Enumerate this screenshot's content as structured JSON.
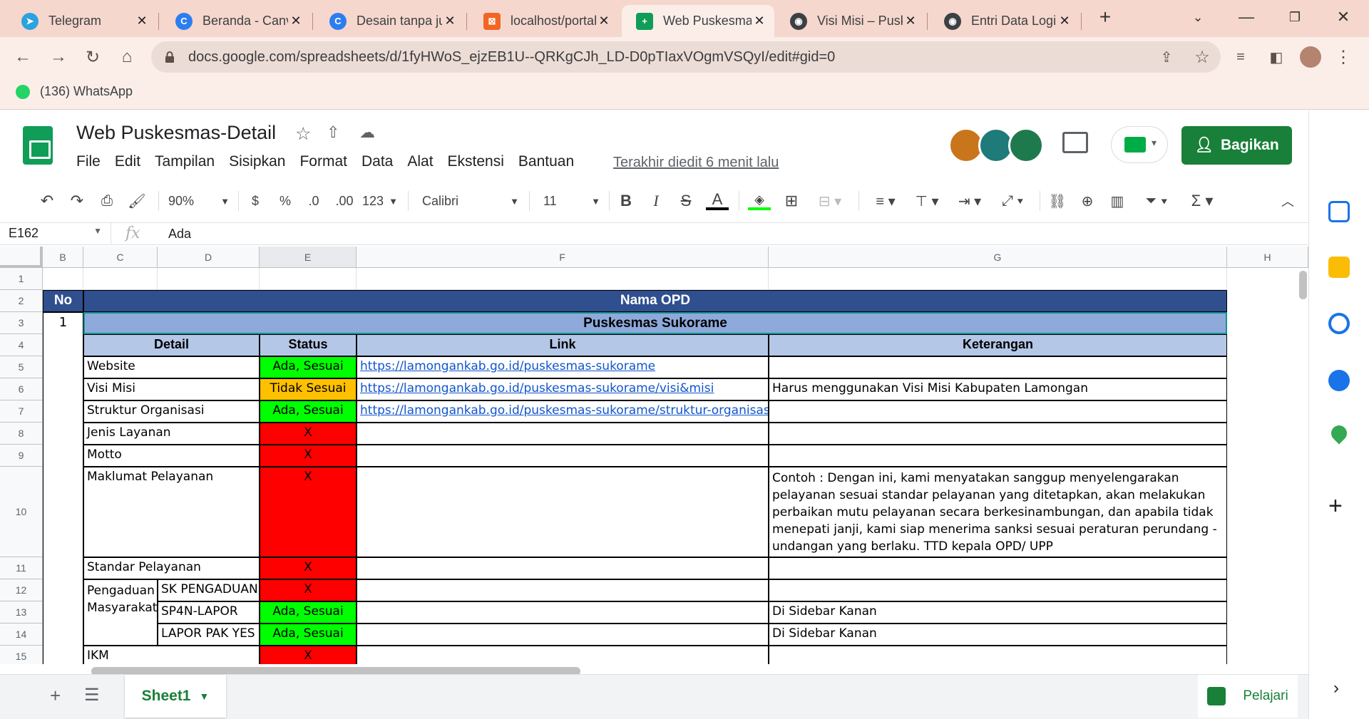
{
  "browser": {
    "tabs": [
      {
        "title": "Telegram",
        "icon": "telegram-icon",
        "color": "#2aa3df"
      },
      {
        "title": "Beranda - Canva",
        "icon": "canva-icon",
        "color": "#2c7ef0"
      },
      {
        "title": "Desain tanpa judul",
        "icon": "canva-icon",
        "color": "#2c7ef0"
      },
      {
        "title": "localhost/portal",
        "icon": "xampp-icon",
        "color": "#f26522"
      },
      {
        "title": "Web Puskesmas",
        "icon": "sheets-icon",
        "color": "#0f9d58"
      },
      {
        "title": "Visi Misi – Pusk",
        "icon": "globe-icon",
        "color": "#3c4043"
      },
      {
        "title": "Entri Data Logi",
        "icon": "globe-icon",
        "color": "#3c4043"
      }
    ],
    "url": "docs.google.com/spreadsheets/d/1fyHWoS_ejzEB1U--QRKgCJh_LD-D0pTIaxVOgmVSQyI/edit#gid=0",
    "bookmark": "(136) WhatsApp"
  },
  "doc": {
    "title": "Web Puskesmas-Detail",
    "menus": [
      "File",
      "Edit",
      "Tampilan",
      "Sisipkan",
      "Format",
      "Data",
      "Alat",
      "Ekstensi",
      "Bantuan"
    ],
    "last_edit": "Terakhir diedit 6 menit lalu",
    "share_label": "Bagikan"
  },
  "toolbar": {
    "zoom": "90%",
    "currency": "$",
    "percent": "%",
    "dec_less": ".0",
    "dec_more": ".00",
    "format_more": "123",
    "font": "Calibri",
    "font_size": "11",
    "bold": "B",
    "italic": "I",
    "strike": "S",
    "text_color": "A"
  },
  "formula": {
    "cell_ref": "E162",
    "fx": "fx",
    "value": "Ada"
  },
  "columns": [
    "B",
    "C",
    "D",
    "E",
    "F",
    "G",
    "H"
  ],
  "rows": [
    "1",
    "2",
    "3",
    "4",
    "5",
    "6",
    "7",
    "8",
    "9",
    "10",
    "11",
    "12",
    "13",
    "14",
    "15"
  ],
  "table": {
    "no_header": "No",
    "opd_header": "Nama OPD",
    "no_value": "1",
    "opd_name": "Puskesmas Sukorame",
    "col_detail": "Detail",
    "col_status": "Status",
    "col_link": "Link",
    "col_keterangan": "Keterangan",
    "items": [
      {
        "detail": "Website",
        "status": "Ada, Sesuai",
        "link": "https://lamongankab.go.id/puskesmas-sukorame",
        "ket": ""
      },
      {
        "detail": "Visi Misi",
        "status": "Tidak Sesuai",
        "link": "https://lamongankab.go.id/puskesmas-sukorame/visi&misi",
        "ket": "Harus menggunakan Visi Misi Kabupaten Lamongan"
      },
      {
        "detail": "Struktur Organisasi",
        "status": "Ada, Sesuai",
        "link": "https://lamongankab.go.id/puskesmas-sukorame/struktur-organisasi",
        "ket": ""
      },
      {
        "detail": "Jenis Layanan",
        "status": "X",
        "link": "",
        "ket": ""
      },
      {
        "detail": "Motto",
        "status": "X",
        "link": "",
        "ket": ""
      },
      {
        "detail": "Maklumat Pelayanan",
        "status": "X",
        "link": "",
        "ket": "Contoh : Dengan ini, kami menyatakan sanggup menyelengarakan pelayanan sesuai standar pelayanan yang ditetapkan, akan melakukan perbaikan mutu pelayanan secara berkesinambungan, dan apabila tidak menepati janji, kami siap menerima sanksi sesuai peraturan perundang -undangan yang berlaku. TTD kepala OPD/ UPP"
      },
      {
        "detail": "Standar Pelayanan",
        "status": "X",
        "link": "",
        "ket": ""
      },
      {
        "detail": "Pengaduan Masyarakat",
        "sub": "SK PENGADUAN",
        "status": "X",
        "link": "",
        "ket": ""
      },
      {
        "sub": "SP4N-LAPOR",
        "status": "Ada, Sesuai",
        "link": "",
        "ket": "Di Sidebar Kanan"
      },
      {
        "sub": "LAPOR PAK YES",
        "status": "Ada, Sesuai",
        "link": "",
        "ket": "Di Sidebar Kanan"
      },
      {
        "detail": "IKM",
        "status": "X",
        "link": "",
        "ket": ""
      }
    ]
  },
  "sheet": {
    "tab": "Sheet1",
    "explore": "Pelajari"
  },
  "colors": {
    "header_dark": "#2f4f8f",
    "header_mid": "#8eaadb",
    "header_light": "#b4c7e7",
    "status_ok": "#00ff00",
    "status_warn": "#ffc000",
    "status_missing": "#ff0000",
    "share_green": "#188038"
  }
}
